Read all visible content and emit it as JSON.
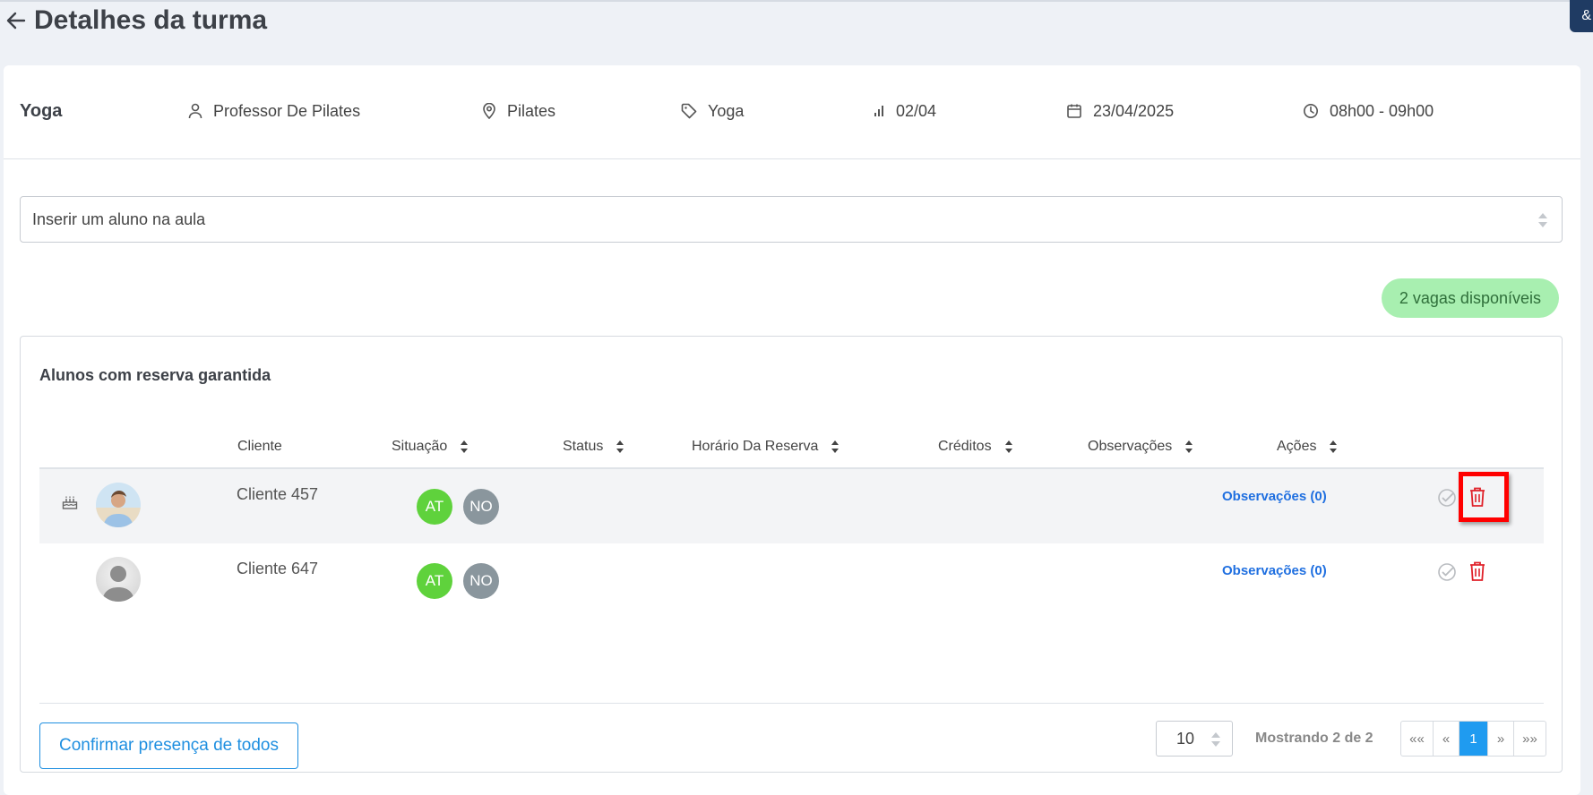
{
  "header": {
    "title": "Detalhes da turma",
    "corner_badge": "&"
  },
  "class_info": {
    "name": "Yoga",
    "teacher": "Professor De Pilates",
    "location": "Pilates",
    "category": "Yoga",
    "occupancy": "02/04",
    "date": "23/04/2025",
    "time": "08h00 - 09h00"
  },
  "student_select": {
    "placeholder": "Inserir um aluno na aula"
  },
  "vacancy_badge": "2 vagas disponíveis",
  "reserved": {
    "title": "Alunos com reserva garantida",
    "columns": {
      "client": "Cliente",
      "situation": "Situação",
      "status": "Status",
      "reservation_time": "Horário Da Reserva",
      "credits": "Créditos",
      "notes": "Observações",
      "actions": "Ações"
    },
    "rows": [
      {
        "client": "Cliente 457",
        "badge_at": "AT",
        "badge_no": "NO",
        "notes_link": "Observações (0)",
        "birthday_icon": "cake-icon",
        "avatar": "photo"
      },
      {
        "client": "Cliente 647",
        "badge_at": "AT",
        "badge_no": "NO",
        "notes_link": "Observações (0)",
        "avatar": "placeholder-person"
      }
    ]
  },
  "pagination": {
    "page_size": "10",
    "showing": "Mostrando 2 de 2",
    "first": "««",
    "prev": "«",
    "current": "1",
    "next": "»",
    "last": "»»"
  },
  "confirm_all_button": "Confirmar presença de todos",
  "colors": {
    "accent": "#1f8fe0",
    "badge_at": "#5fd23c",
    "badge_no": "#8a969d",
    "vacancy_bg": "#a8efb0",
    "delete": "#e0222a",
    "highlight": "#ff0000"
  }
}
